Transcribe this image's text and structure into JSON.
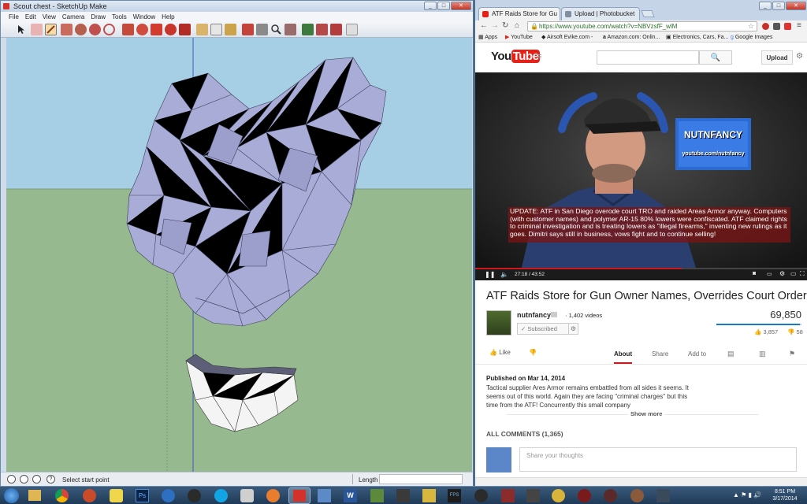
{
  "sketchup": {
    "title": "Scout chest - SketchUp Make",
    "menu": [
      "File",
      "Edit",
      "View",
      "Camera",
      "Draw",
      "Tools",
      "Window",
      "Help"
    ],
    "status_text": "Select start point",
    "length_label": "Length"
  },
  "chrome": {
    "tabs": [
      {
        "label": "ATF Raids Store for Gu",
        "active": true
      },
      {
        "label": "Upload | Photobucket",
        "active": false
      }
    ],
    "url": "https://www.youtube.com/watch?v=NBVzsfF_wlM",
    "bookmarks": [
      "Apps",
      "YouTube",
      "Airsoft Evike.com -",
      "Amazon.com: Onlin...",
      "Electronics, Cars, Fa...",
      "Google Images"
    ]
  },
  "youtube": {
    "upload_label": "Upload",
    "overlay": {
      "title_line1": "NUTNFANCY",
      "title_line2": "youtube.com/nutnfancy"
    },
    "caption": "UPDATE: ATF in San Diego overode court TRO and raided Areas Armor anyway.  Computers (with customer names) and polymer AR-15 80% lowers were confiscated.  ATF claimed rights to criminal investigation and is treating lowers as \"illegal firearms,\" inventing new rulings as it goes.  Dimitri says still in business, vows fight and to continue selling!",
    "time": "27:18 / 43:52",
    "progress": 0.62,
    "video_title": "ATF Raids Store for Gun Owner Names, Overrides Court Order",
    "channel": "nutnfancy",
    "videos_count": "· 1,402 videos",
    "subscribed": "Subscribed",
    "views": "69,850",
    "likes": "3,857",
    "dislikes": "58",
    "like_label": "Like",
    "tabs": [
      "About",
      "Share",
      "Add to"
    ],
    "published": "Published on Mar 14, 2014",
    "description": "Tactical supplier Ares Armor remains embattled from all sides it seems. It seems out of this world. Again they are facing \"criminal charges\" but this time from the ATF! Concurrently this small company",
    "show_more": "Show more",
    "comments_header": "ALL COMMENTS (1,365)",
    "share_placeholder": "Share your thoughts"
  },
  "taskbar": {
    "time": "8:51 PM",
    "date": "3/17/2014"
  }
}
